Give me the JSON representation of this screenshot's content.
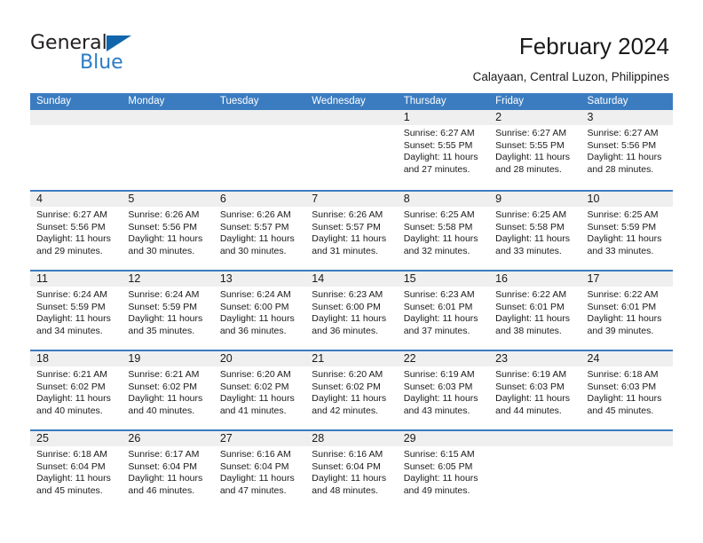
{
  "branding": {
    "logo_primary": "General",
    "logo_secondary": "Blue",
    "logo_accent_color": "#1166ab",
    "logo_text_color": "#231f20",
    "logo_secondary_color": "#2b7cc4"
  },
  "header": {
    "title": "February 2024",
    "subtitle": "Calayaan, Central Luzon, Philippines"
  },
  "theme": {
    "header_bg": "#3b7cc0",
    "header_text": "#ffffff",
    "daynum_band_bg": "#efefef",
    "cell_bg": "#ffffff",
    "week_rule": "#3b7cc0"
  },
  "calendar": {
    "weekday_headers": [
      "Sunday",
      "Monday",
      "Tuesday",
      "Wednesday",
      "Thursday",
      "Friday",
      "Saturday"
    ],
    "weeks": [
      [
        {
          "day": "",
          "empty": true
        },
        {
          "day": "",
          "empty": true
        },
        {
          "day": "",
          "empty": true
        },
        {
          "day": "",
          "empty": true
        },
        {
          "day": "1",
          "sunrise": "Sunrise: 6:27 AM",
          "sunset": "Sunset: 5:55 PM",
          "daylight_line1": "Daylight: 11 hours",
          "daylight_line2": "and 27 minutes."
        },
        {
          "day": "2",
          "sunrise": "Sunrise: 6:27 AM",
          "sunset": "Sunset: 5:55 PM",
          "daylight_line1": "Daylight: 11 hours",
          "daylight_line2": "and 28 minutes."
        },
        {
          "day": "3",
          "sunrise": "Sunrise: 6:27 AM",
          "sunset": "Sunset: 5:56 PM",
          "daylight_line1": "Daylight: 11 hours",
          "daylight_line2": "and 28 minutes."
        }
      ],
      [
        {
          "day": "4",
          "sunrise": "Sunrise: 6:27 AM",
          "sunset": "Sunset: 5:56 PM",
          "daylight_line1": "Daylight: 11 hours",
          "daylight_line2": "and 29 minutes."
        },
        {
          "day": "5",
          "sunrise": "Sunrise: 6:26 AM",
          "sunset": "Sunset: 5:56 PM",
          "daylight_line1": "Daylight: 11 hours",
          "daylight_line2": "and 30 minutes."
        },
        {
          "day": "6",
          "sunrise": "Sunrise: 6:26 AM",
          "sunset": "Sunset: 5:57 PM",
          "daylight_line1": "Daylight: 11 hours",
          "daylight_line2": "and 30 minutes."
        },
        {
          "day": "7",
          "sunrise": "Sunrise: 6:26 AM",
          "sunset": "Sunset: 5:57 PM",
          "daylight_line1": "Daylight: 11 hours",
          "daylight_line2": "and 31 minutes."
        },
        {
          "day": "8",
          "sunrise": "Sunrise: 6:25 AM",
          "sunset": "Sunset: 5:58 PM",
          "daylight_line1": "Daylight: 11 hours",
          "daylight_line2": "and 32 minutes."
        },
        {
          "day": "9",
          "sunrise": "Sunrise: 6:25 AM",
          "sunset": "Sunset: 5:58 PM",
          "daylight_line1": "Daylight: 11 hours",
          "daylight_line2": "and 33 minutes."
        },
        {
          "day": "10",
          "sunrise": "Sunrise: 6:25 AM",
          "sunset": "Sunset: 5:59 PM",
          "daylight_line1": "Daylight: 11 hours",
          "daylight_line2": "and 33 minutes."
        }
      ],
      [
        {
          "day": "11",
          "sunrise": "Sunrise: 6:24 AM",
          "sunset": "Sunset: 5:59 PM",
          "daylight_line1": "Daylight: 11 hours",
          "daylight_line2": "and 34 minutes."
        },
        {
          "day": "12",
          "sunrise": "Sunrise: 6:24 AM",
          "sunset": "Sunset: 5:59 PM",
          "daylight_line1": "Daylight: 11 hours",
          "daylight_line2": "and 35 minutes."
        },
        {
          "day": "13",
          "sunrise": "Sunrise: 6:24 AM",
          "sunset": "Sunset: 6:00 PM",
          "daylight_line1": "Daylight: 11 hours",
          "daylight_line2": "and 36 minutes."
        },
        {
          "day": "14",
          "sunrise": "Sunrise: 6:23 AM",
          "sunset": "Sunset: 6:00 PM",
          "daylight_line1": "Daylight: 11 hours",
          "daylight_line2": "and 36 minutes."
        },
        {
          "day": "15",
          "sunrise": "Sunrise: 6:23 AM",
          "sunset": "Sunset: 6:01 PM",
          "daylight_line1": "Daylight: 11 hours",
          "daylight_line2": "and 37 minutes."
        },
        {
          "day": "16",
          "sunrise": "Sunrise: 6:22 AM",
          "sunset": "Sunset: 6:01 PM",
          "daylight_line1": "Daylight: 11 hours",
          "daylight_line2": "and 38 minutes."
        },
        {
          "day": "17",
          "sunrise": "Sunrise: 6:22 AM",
          "sunset": "Sunset: 6:01 PM",
          "daylight_line1": "Daylight: 11 hours",
          "daylight_line2": "and 39 minutes."
        }
      ],
      [
        {
          "day": "18",
          "sunrise": "Sunrise: 6:21 AM",
          "sunset": "Sunset: 6:02 PM",
          "daylight_line1": "Daylight: 11 hours",
          "daylight_line2": "and 40 minutes."
        },
        {
          "day": "19",
          "sunrise": "Sunrise: 6:21 AM",
          "sunset": "Sunset: 6:02 PM",
          "daylight_line1": "Daylight: 11 hours",
          "daylight_line2": "and 40 minutes."
        },
        {
          "day": "20",
          "sunrise": "Sunrise: 6:20 AM",
          "sunset": "Sunset: 6:02 PM",
          "daylight_line1": "Daylight: 11 hours",
          "daylight_line2": "and 41 minutes."
        },
        {
          "day": "21",
          "sunrise": "Sunrise: 6:20 AM",
          "sunset": "Sunset: 6:02 PM",
          "daylight_line1": "Daylight: 11 hours",
          "daylight_line2": "and 42 minutes."
        },
        {
          "day": "22",
          "sunrise": "Sunrise: 6:19 AM",
          "sunset": "Sunset: 6:03 PM",
          "daylight_line1": "Daylight: 11 hours",
          "daylight_line2": "and 43 minutes."
        },
        {
          "day": "23",
          "sunrise": "Sunrise: 6:19 AM",
          "sunset": "Sunset: 6:03 PM",
          "daylight_line1": "Daylight: 11 hours",
          "daylight_line2": "and 44 minutes."
        },
        {
          "day": "24",
          "sunrise": "Sunrise: 6:18 AM",
          "sunset": "Sunset: 6:03 PM",
          "daylight_line1": "Daylight: 11 hours",
          "daylight_line2": "and 45 minutes."
        }
      ],
      [
        {
          "day": "25",
          "sunrise": "Sunrise: 6:18 AM",
          "sunset": "Sunset: 6:04 PM",
          "daylight_line1": "Daylight: 11 hours",
          "daylight_line2": "and 45 minutes."
        },
        {
          "day": "26",
          "sunrise": "Sunrise: 6:17 AM",
          "sunset": "Sunset: 6:04 PM",
          "daylight_line1": "Daylight: 11 hours",
          "daylight_line2": "and 46 minutes."
        },
        {
          "day": "27",
          "sunrise": "Sunrise: 6:16 AM",
          "sunset": "Sunset: 6:04 PM",
          "daylight_line1": "Daylight: 11 hours",
          "daylight_line2": "and 47 minutes."
        },
        {
          "day": "28",
          "sunrise": "Sunrise: 6:16 AM",
          "sunset": "Sunset: 6:04 PM",
          "daylight_line1": "Daylight: 11 hours",
          "daylight_line2": "and 48 minutes."
        },
        {
          "day": "29",
          "sunrise": "Sunrise: 6:15 AM",
          "sunset": "Sunset: 6:05 PM",
          "daylight_line1": "Daylight: 11 hours",
          "daylight_line2": "and 49 minutes."
        },
        {
          "day": "",
          "empty": true
        },
        {
          "day": "",
          "empty": true
        }
      ]
    ]
  }
}
